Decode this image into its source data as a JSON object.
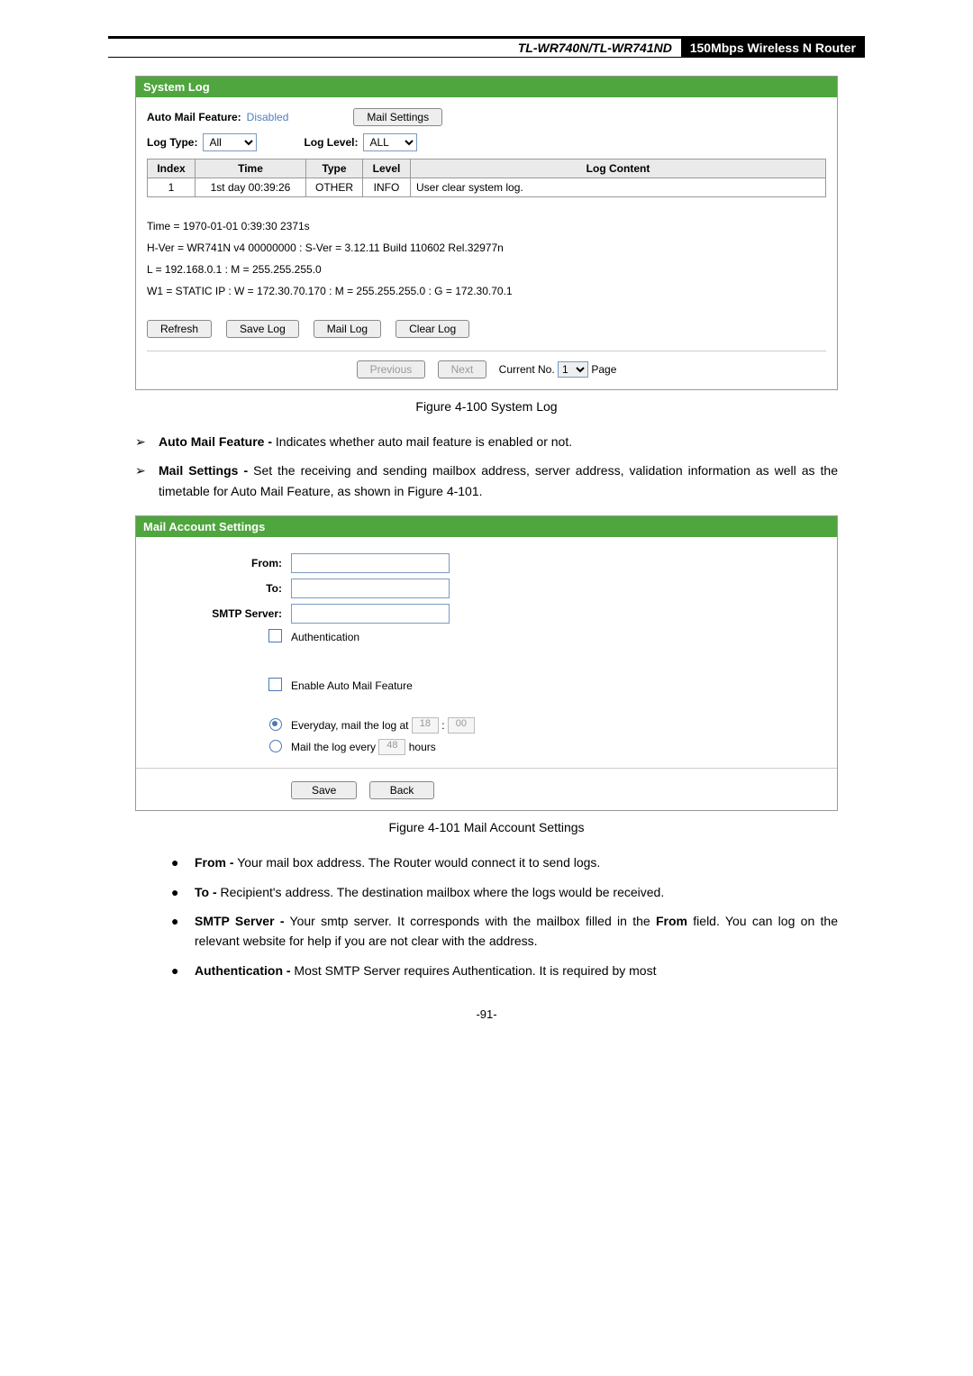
{
  "header": {
    "model": "TL-WR740N/TL-WR741ND",
    "tagline": "150Mbps Wireless N Router"
  },
  "syslog": {
    "title": "System Log",
    "auto_mail_label": "Auto Mail Feature:",
    "auto_mail_value": "Disabled",
    "mail_settings_btn": "Mail Settings",
    "log_type_label": "Log Type:",
    "log_type_value": "All",
    "log_level_label": "Log Level:",
    "log_level_value": "ALL",
    "th_index": "Index",
    "th_time": "Time",
    "th_type": "Type",
    "th_level": "Level",
    "th_content": "Log Content",
    "row": {
      "index": "1",
      "time": "1st day 00:39:26",
      "type": "OTHER",
      "level": "INFO",
      "content": "User clear system log."
    },
    "info1": "Time = 1970-01-01 0:39:30 2371s",
    "info2": "H-Ver = WR741N v4 00000000 : S-Ver = 3.12.11 Build 110602 Rel.32977n",
    "info3": "L = 192.168.0.1 : M = 255.255.255.0",
    "info4": "W1 = STATIC IP : W = 172.30.70.170 : M = 255.255.255.0 : G = 172.30.70.1",
    "btn_refresh": "Refresh",
    "btn_savelog": "Save Log",
    "btn_maillog": "Mail Log",
    "btn_clearlog": "Clear Log",
    "prev": "Previous",
    "next": "Next",
    "current_no": "Current No.",
    "current_val": "1",
    "page": "Page"
  },
  "fig100": "Figure 4-100    System Log",
  "desc1_bold": "Auto Mail Feature -",
  "desc1_rest": " Indicates whether auto mail feature is enabled or not.",
  "desc2_bold": "Mail Settings -",
  "desc2_rest": " Set the receiving and sending mailbox address, server address, validation information as well as the timetable for Auto Mail Feature, as shown in Figure 4-101.",
  "mail": {
    "title": "Mail Account Settings",
    "from": "From:",
    "to": "To:",
    "smtp": "SMTP Server:",
    "auth": "Authentication",
    "enable": "Enable Auto Mail Feature",
    "everyday": "Everyday, mail the log at",
    "hh": "18",
    "mm": "00",
    "colon": ":",
    "every": "Mail the log every",
    "every_hours": "48",
    "hours": "hours",
    "save": "Save",
    "back": "Back"
  },
  "fig101": "Figure 4-101    Mail Account Settings",
  "b1_bold": "From -",
  "b1_rest": " Your mail box address. The Router would connect it to send logs.",
  "b2_bold": "To -",
  "b2_rest": " Recipient's address. The destination mailbox where the logs would be received.",
  "b3_bold": "SMTP Server -",
  "b3_rest": " Your smtp server. It corresponds with the mailbox filled in the ",
  "b3_bold2": "From",
  "b3_rest2": " field. You can log on the relevant website for help if you are not clear with the address.",
  "b4_bold": "Authentication -",
  "b4_rest": " Most SMTP Server requires Authentication. It is required by most",
  "page_num": "-91-"
}
